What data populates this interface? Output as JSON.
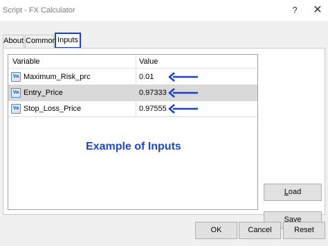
{
  "window": {
    "title": "Script - FX Calculator",
    "help_glyph": "?",
    "close_glyph": "✕"
  },
  "tabs": [
    {
      "label": "About"
    },
    {
      "label": "Common"
    },
    {
      "label": "Inputs",
      "active": true
    }
  ],
  "inputs_table": {
    "headers": {
      "variable": "Variable",
      "value": "Value"
    },
    "rows": [
      {
        "name": "Maximum_Risk_prc",
        "value": "0.01",
        "selected": false
      },
      {
        "name": "Entry_Price",
        "value": "0.97333",
        "selected": true
      },
      {
        "name": "Stop_Loss_Price",
        "value": "0.97555",
        "selected": false
      }
    ],
    "row_icon": "variable-icon",
    "icon_glyph": "Va"
  },
  "caption": "Example of Inputs",
  "colors": {
    "accent": "#1a3fcf",
    "caption": "#1d46c9",
    "arrow": "#1a3fcf"
  },
  "buttons": {
    "load": {
      "pre": "",
      "u": "L",
      "post": "oad"
    },
    "save": {
      "pre": "",
      "u": "S",
      "post": "ave"
    },
    "ok": "OK",
    "cancel": "Cancel",
    "reset": "Reset"
  }
}
